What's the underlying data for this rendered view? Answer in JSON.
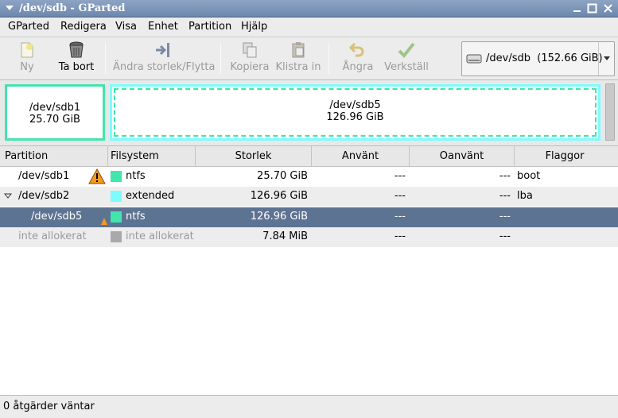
{
  "window": {
    "title": "/dev/sdb - GParted"
  },
  "menu": [
    "GParted",
    "Redigera",
    "Visa",
    "Enhet",
    "Partition",
    "Hjälp"
  ],
  "toolbar": {
    "new": "Ny",
    "delete": "Ta bort",
    "resize_move": "Ändra storlek/Flytta",
    "copy": "Kopiera",
    "paste": "Klistra in",
    "undo": "Ångra",
    "apply": "Verkställ"
  },
  "device": {
    "path": "/dev/sdb",
    "size": "(152.66 GiB)"
  },
  "visual": {
    "sdb1": {
      "name": "/dev/sdb1",
      "size": "25.70 GiB"
    },
    "sdb5": {
      "name": "/dev/sdb5",
      "size": "126.96 GiB"
    }
  },
  "columns": [
    "Partition",
    "Filsystem",
    "Storlek",
    "Använt",
    "Oanvänt",
    "Flaggor"
  ],
  "rows": [
    {
      "partition": "/dev/sdb1",
      "filesystem": "ntfs",
      "size": "25.70 GiB",
      "used": "---",
      "unused": "---",
      "flags": "boot",
      "color": "#42e5ac"
    },
    {
      "partition": "/dev/sdb2",
      "filesystem": "extended",
      "size": "126.96 GiB",
      "used": "---",
      "unused": "---",
      "flags": "lba",
      "color": "#7dfcfe"
    },
    {
      "partition": "/dev/sdb5",
      "filesystem": "ntfs",
      "size": "126.96 GiB",
      "used": "---",
      "unused": "---",
      "flags": "",
      "color": "#42e5ac"
    },
    {
      "partition": "inte allokerat",
      "filesystem": "inte allokerat",
      "size": "7.84 MiB",
      "used": "---",
      "unused": "---",
      "flags": "",
      "color": "#a9a9a9"
    }
  ],
  "status": "0 åtgärder väntar"
}
